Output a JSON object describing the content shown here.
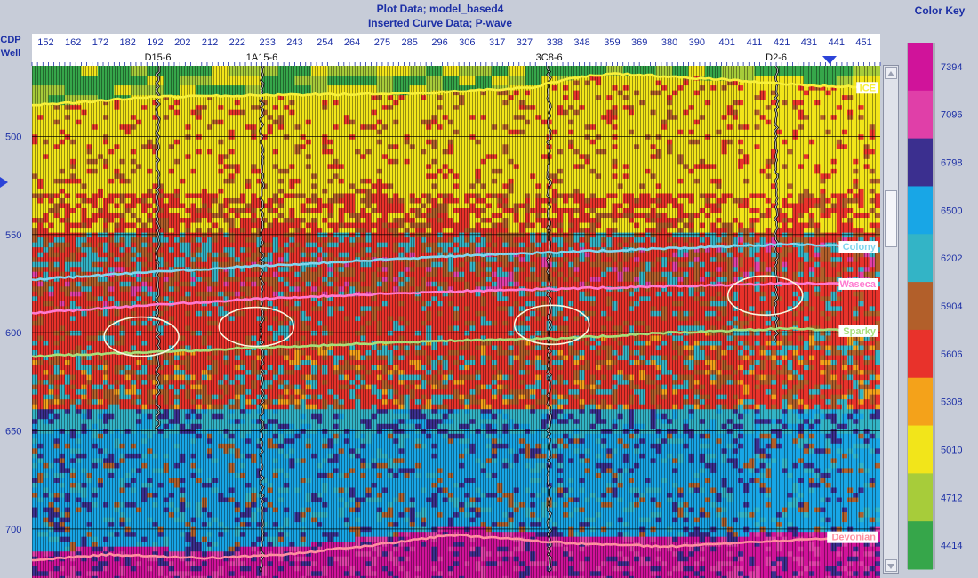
{
  "header": {
    "title": "Plot Data; model_based4",
    "subtitle": "Inserted Curve Data;  P-wave"
  },
  "axis": {
    "cdp_label": "CDP",
    "well_label": "Well"
  },
  "colorkey": {
    "title": "Color Key"
  },
  "chart_data": {
    "type": "heatmap",
    "title": "Plot Data; model_based4",
    "subtitle": "Inserted Curve Data;  P-wave",
    "x": {
      "label": "CDP",
      "ticks": [
        152,
        162,
        172,
        182,
        192,
        202,
        212,
        222,
        233,
        243,
        254,
        264,
        275,
        285,
        296,
        306,
        317,
        327,
        338,
        348,
        359,
        369,
        380,
        390,
        401,
        411,
        421,
        431,
        441,
        451
      ],
      "range": [
        147,
        457
      ]
    },
    "y": {
      "ticks": [
        500,
        550,
        600,
        650,
        700
      ],
      "range": [
        464,
        725
      ]
    },
    "wells": [
      {
        "name": "D15-6",
        "cdp": 193
      },
      {
        "name": "1A15-6",
        "cdp": 231
      },
      {
        "name": "3C8-6",
        "cdp": 336
      },
      {
        "name": "D2-6",
        "cdp": 419
      }
    ],
    "horizons": [
      {
        "name": "ICE",
        "color": "#f8f03a",
        "points": [
          [
            147,
            484
          ],
          [
            160,
            483
          ],
          [
            190,
            480
          ],
          [
            230,
            479
          ],
          [
            290,
            478
          ],
          [
            330,
            475
          ],
          [
            345,
            470
          ],
          [
            360,
            468
          ],
          [
            400,
            471
          ],
          [
            430,
            474
          ],
          [
            457,
            475
          ]
        ]
      },
      {
        "name": "Colony",
        "color": "#7fd6ef",
        "points": [
          [
            147,
            573
          ],
          [
            180,
            570
          ],
          [
            230,
            566
          ],
          [
            300,
            561
          ],
          [
            360,
            558
          ],
          [
            420,
            555
          ],
          [
            457,
            556
          ]
        ]
      },
      {
        "name": "Waseca",
        "color": "#ff7ad0",
        "points": [
          [
            147,
            590
          ],
          [
            190,
            586
          ],
          [
            240,
            582
          ],
          [
            300,
            579
          ],
          [
            360,
            577
          ],
          [
            420,
            575
          ],
          [
            457,
            575
          ]
        ]
      },
      {
        "name": "Sparky",
        "color": "#a6e07a",
        "points": [
          [
            147,
            612
          ],
          [
            190,
            610
          ],
          [
            240,
            607
          ],
          [
            300,
            604
          ],
          [
            340,
            603
          ],
          [
            380,
            600
          ],
          [
            420,
            598
          ],
          [
            457,
            599
          ]
        ]
      },
      {
        "name": "Devonian",
        "color": "#ff8fa0",
        "points": [
          [
            147,
            716
          ],
          [
            175,
            713
          ],
          [
            210,
            715
          ],
          [
            240,
            713
          ],
          [
            280,
            707
          ],
          [
            300,
            703
          ],
          [
            340,
            707
          ],
          [
            380,
            709
          ],
          [
            420,
            706
          ],
          [
            457,
            704
          ]
        ]
      }
    ],
    "colorkey": [
      {
        "value": 7394,
        "color": "#d0139a"
      },
      {
        "value": 7096,
        "color": "#e03fa8"
      },
      {
        "value": 6798,
        "color": "#3b2f8f"
      },
      {
        "value": 6500,
        "color": "#18a6e6"
      },
      {
        "value": 6202,
        "color": "#33b4c6"
      },
      {
        "value": 5904,
        "color": "#b25f2a"
      },
      {
        "value": 5606,
        "color": "#e8322b"
      },
      {
        "value": 5308,
        "color": "#f4a21a"
      },
      {
        "value": 5010,
        "color": "#f2e51a"
      },
      {
        "value": 4712,
        "color": "#a7cc3a"
      },
      {
        "value": 4414,
        "color": "#36a64a"
      }
    ],
    "ellipses": [
      {
        "well": "D15-6",
        "cdp": 187,
        "depth": 602
      },
      {
        "well": "1A15-6",
        "cdp": 229,
        "depth": 597
      },
      {
        "well": "3C8-6",
        "cdp": 337,
        "depth": 596
      },
      {
        "well": "D2-6",
        "cdp": 415,
        "depth": 581
      }
    ]
  }
}
